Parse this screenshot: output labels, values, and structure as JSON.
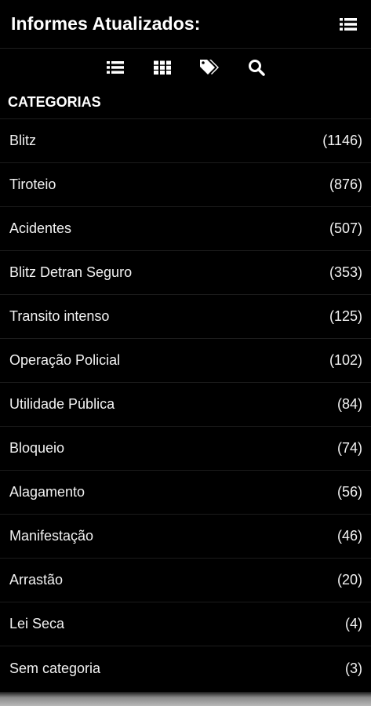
{
  "header": {
    "title": "Informes Atualizados:",
    "menu_icon": "list-menu-icon"
  },
  "toolbar": {
    "icons": [
      "list-icon",
      "grid-icon",
      "tags-icon",
      "search-icon"
    ]
  },
  "section": {
    "title": "CATEGORIAS"
  },
  "categories": [
    {
      "label": "Blitz",
      "count": "(1146)"
    },
    {
      "label": "Tiroteio",
      "count": "(876)"
    },
    {
      "label": "Acidentes",
      "count": "(507)"
    },
    {
      "label": "Blitz Detran Seguro",
      "count": "(353)"
    },
    {
      "label": "Transito intenso",
      "count": "(125)"
    },
    {
      "label": "Operação Policial",
      "count": "(102)"
    },
    {
      "label": "Utilidade Pública",
      "count": "(84)"
    },
    {
      "label": "Bloqueio",
      "count": "(74)"
    },
    {
      "label": "Alagamento",
      "count": "(56)"
    },
    {
      "label": "Manifestação",
      "count": "(46)"
    },
    {
      "label": "Arrastão",
      "count": "(20)"
    },
    {
      "label": "Lei Seca",
      "count": "(4)"
    },
    {
      "label": "Sem categoria",
      "count": "(3)"
    }
  ],
  "colors": {
    "background": "#000000",
    "text": "#ffffff",
    "divider": "#1c1c1c"
  }
}
